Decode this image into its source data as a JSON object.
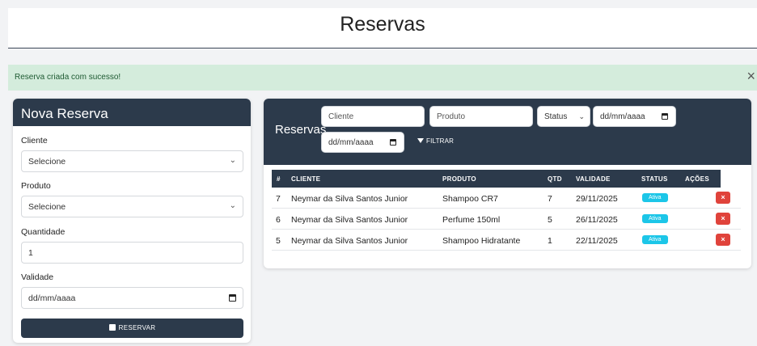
{
  "header": {
    "title": "Reservas"
  },
  "alert": {
    "message": "Reserva criada com sucesso!",
    "close_icon": "×"
  },
  "form": {
    "title": "Nova Reserva",
    "cliente": {
      "label": "Cliente",
      "value": "Selecione"
    },
    "produto": {
      "label": "Produto",
      "value": "Selecione"
    },
    "quantidade": {
      "label": "Quantidade",
      "value": "1"
    },
    "validade": {
      "label": "Validade",
      "placeholder": "dd/mm/aaaa"
    },
    "submit_label": "RESERVAR"
  },
  "list": {
    "title": "Reservas",
    "filters": {
      "cliente_placeholder": "Cliente",
      "produto_placeholder": "Produto",
      "status_value": "Status",
      "date_from": "dd/mm/aaaa",
      "date_to": "dd/mm/aaaa",
      "filter_label": "FILTRAR"
    },
    "columns": [
      "#",
      "CLIENTE",
      "PRODUTO",
      "QTD",
      "VALIDADE",
      "STATUS",
      "AÇÕES"
    ],
    "rows": [
      {
        "id": "7",
        "cliente": "Neymar da Silva Santos Junior",
        "produto": "Shampoo CR7",
        "qtd": "7",
        "validade": "29/11/2025",
        "status": "Ativa",
        "action": "×"
      },
      {
        "id": "6",
        "cliente": "Neymar da Silva Santos Junior",
        "produto": "Perfume 150ml",
        "qtd": "5",
        "validade": "26/11/2025",
        "status": "Ativa",
        "action": "×"
      },
      {
        "id": "5",
        "cliente": "Neymar da Silva Santos Junior",
        "produto": "Shampoo Hidratante",
        "qtd": "1",
        "validade": "22/11/2025",
        "status": "Ativa",
        "action": "×"
      }
    ]
  },
  "colors": {
    "dark": "#2c3a4b",
    "success_bg": "#d4ecdc",
    "badge": "#1cc6e8",
    "danger": "#e0433b"
  },
  "icons": {
    "close": "close-icon",
    "chevron": "chevron-down-icon",
    "calendar": "calendar-icon",
    "filter": "filter-icon",
    "save": "save-icon"
  }
}
